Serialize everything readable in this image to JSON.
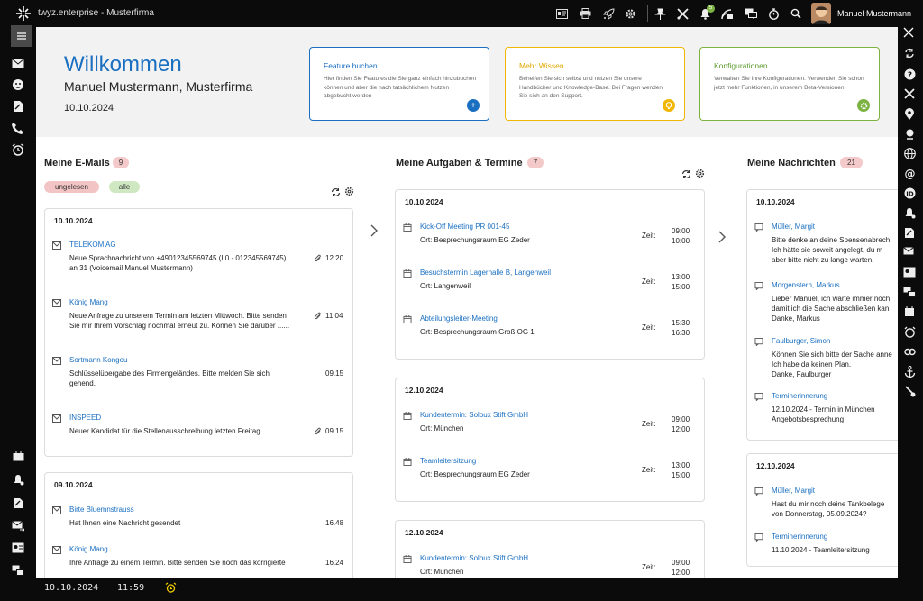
{
  "app_title": "twyz.enterprise - Musterfirma",
  "user_name": "Manuel Mustermann",
  "notification_badge": "5",
  "hero": {
    "title": "Willkommen",
    "subtitle": "Manuel Mustermann, Musterfirma",
    "date": "10.10.2024"
  },
  "cards": [
    {
      "title": "Feature buchen",
      "text": "Hier finden Sie Features die Sie ganz einfach hinzubuchen können und aber die nach tatsächlichem Nutzen abgebucht werden",
      "color": "#1a6fc1"
    },
    {
      "title": "Mehr Wissen",
      "text": "Behelfen Sie sich selbst und nutzen Sie unsere Handbücher und Knowledge-Base. Bei Fragen wenden Sie sich an den Support.",
      "color": "#f2b705"
    },
    {
      "title": "Konfigurationen",
      "text": "Verwalten Sie Ihre Konfigurationen. Verwenden Sie schon jetzt mehr Funktionen, in unserem Beta-Versionen.",
      "color": "#7cb342"
    }
  ],
  "emails": {
    "title": "Meine E-Mails",
    "count": "9",
    "filter_unread": "ungelesen",
    "filter_all": "alle",
    "groups": [
      {
        "date": "10.10.2024",
        "items": [
          {
            "sender": "TELEKOM AG",
            "text": [
              "Neue Sprachnachricht von +49012345569745 (L0 - 012345569745)",
              "an 31 (Voicemail Manuel Mustermann)"
            ],
            "time": "12.20",
            "attachment": true
          },
          {
            "sender": "König Mang",
            "text": [
              "Neue Anfrage zu unserem Termin am letzten Mittwoch. Bitte senden",
              "Sie mir Ihrem Vorschlag nochmal erneut zu. Können Sie darüber ......"
            ],
            "time": "11.04",
            "attachment": true
          },
          {
            "sender": "Sortmann Kongou",
            "text": [
              "Schlüsselübergabe des Firmengeländes. Bitte melden Sie sich",
              "gehend."
            ],
            "time": "09.15",
            "attachment": false
          },
          {
            "sender": "INSPEED",
            "text": [
              "Neuer Kandidat für die Stellenausschreibung letzten Freitag."
            ],
            "time": "09.15",
            "attachment": true
          }
        ]
      },
      {
        "date": "09.10.2024",
        "items": [
          {
            "sender": "Birte Bluemnstrauss",
            "text": [
              "Hat Ihnen eine Nachricht gesendet"
            ],
            "time": "16.48",
            "attachment": false
          },
          {
            "sender": "König Mang",
            "text": [
              "Ihre Anfrage zu einem Termin. Bitte senden Sie noch das korrigierte"
            ],
            "time": "16.24",
            "attachment": false
          }
        ]
      }
    ]
  },
  "tasks": {
    "title": "Meine Aufgaben & Termine",
    "count": "7",
    "time_label": "Zeit:",
    "groups": [
      {
        "date": "10.10.2024",
        "items": [
          {
            "title": "Kick-Off Meeting PR 001-45",
            "place": "Ort: Besprechungsraum EG Zeder",
            "start": "09:00",
            "end": "10:00"
          },
          {
            "title": "Besuchstermin Lagerhalle B, Langenweil",
            "place": "Ort: Langenweil",
            "start": "13:00",
            "end": "15:00"
          },
          {
            "title": "Abteilungsleiter-Meeting",
            "place": "Ort: Besprechungsraum Groß OG 1",
            "start": "15:30",
            "end": "16:30"
          }
        ]
      },
      {
        "date": "12.10.2024",
        "items": [
          {
            "title": "Kundentermin: Soloux Stift GmbH",
            "place": "Ort: München",
            "start": "09:00",
            "end": "12:00"
          },
          {
            "title": "Teamleitersitzung",
            "place": "Ort: Besprechungsraum EG Zeder",
            "start": "13:00",
            "end": "15:00"
          }
        ]
      },
      {
        "date": "12.10.2024",
        "items": [
          {
            "title": "Kundentermin: Soloux Stift GmbH",
            "place": "Ort: München",
            "start": "09:00",
            "end": "12:00"
          }
        ]
      }
    ]
  },
  "messages": {
    "title": "Meine Nachrichten",
    "count": "21",
    "groups": [
      {
        "date": "10.10.2024",
        "items": [
          {
            "sender": "Müller, Margit",
            "text": [
              "Bitte denke an deine Spensenabrech",
              "Ich hätte sie soweit angelegt, du m",
              "aber bitte nicht zu lange warten."
            ]
          },
          {
            "sender": "Morgenstern, Markus",
            "text": [
              "Lieber Manuel, ich warte immer noch",
              "damit ich die Sache abschließen kan",
              "Danke, Markus"
            ]
          },
          {
            "sender": "Faulburger, Simon",
            "text": [
              "Können Sie sich bitte der Sache anne",
              "Ich habe da keinen Plan.",
              "Danke, Faulburger"
            ]
          },
          {
            "sender": "Terminerinnerung",
            "text": [
              "12.10.2024 - Termin in München",
              "Angebotsbesprechung"
            ]
          }
        ]
      },
      {
        "date": "12.10.2024",
        "items": [
          {
            "sender": "Müller, Margit",
            "text": [
              "Hast du mir noch deine Tankbelege",
              "von Donnerstag, 05.09.2024?"
            ]
          },
          {
            "sender": "Terminerinnerung",
            "text": [
              "11.10.2024 - Teamleitersitzung"
            ]
          }
        ]
      }
    ]
  },
  "statusbar": {
    "date": "10.10.2024",
    "time": "11:59"
  },
  "icons": {
    "top": [
      "id-card-icon",
      "print-icon",
      "rocket-icon",
      "gear-icon",
      "pin-icon",
      "tools-icon",
      "bell-icon",
      "messages-icon",
      "chat-icon",
      "stopwatch-icon",
      "search-icon"
    ],
    "left": [
      "mail-icon",
      "contacts-icon",
      "document-icon",
      "phone-icon",
      "alarm-icon"
    ]
  }
}
